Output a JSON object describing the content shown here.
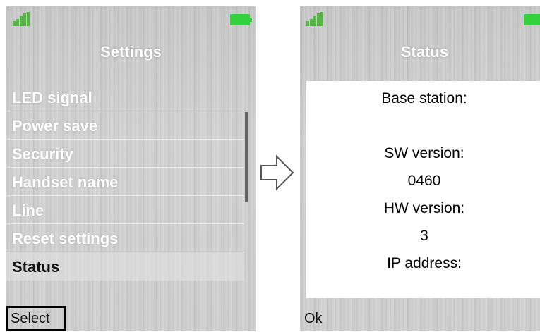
{
  "left_screen": {
    "title": "Settings",
    "menu_items": [
      {
        "label": "LED signal"
      },
      {
        "label": "Power save"
      },
      {
        "label": "Security"
      },
      {
        "label": "Handset name"
      },
      {
        "label": "Line"
      },
      {
        "label": "Reset settings"
      },
      {
        "label": "Status",
        "selected": true
      }
    ],
    "softkey_left": "Select",
    "signal_icon": "signal-strength-icon",
    "battery_icon": "battery-full-icon",
    "accent_color": "#33d13e"
  },
  "transition_icon": "arrow-right-icon",
  "right_screen": {
    "title": "Status",
    "lines": [
      "Base station:",
      "",
      "SW version:",
      "0460",
      "HW version:",
      "3",
      "IP address:"
    ],
    "softkey_left": "Ok"
  }
}
